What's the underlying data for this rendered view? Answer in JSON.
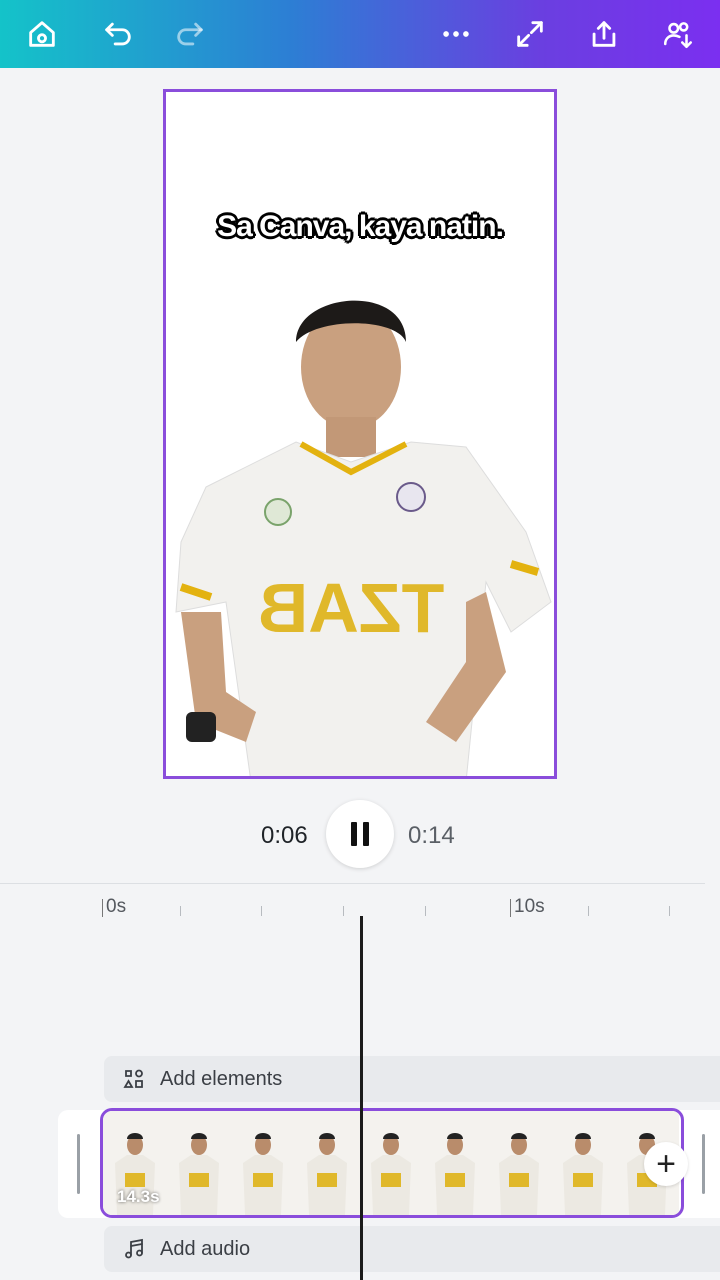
{
  "toolbar": {
    "icons": [
      "home-icon",
      "undo-icon",
      "redo-icon",
      "more-icon",
      "fullscreen-icon",
      "share-icon",
      "collaborate-icon"
    ]
  },
  "canvas": {
    "caption": "Sa Canva, kaya natin.",
    "border_color": "#8a4ddb"
  },
  "player": {
    "current_time": "0:06",
    "total_time": "0:14",
    "state": "playing"
  },
  "timeline": {
    "ruler_labels": [
      "0s",
      "10s"
    ],
    "add_elements_label": "Add elements",
    "add_audio_label": "Add audio",
    "clip_duration": "14.3s",
    "add_clip_symbol": "+"
  },
  "colors": {
    "accent": "#8a4ddb",
    "topbar_start": "#14c3c9",
    "topbar_end": "#7b2ff0"
  }
}
